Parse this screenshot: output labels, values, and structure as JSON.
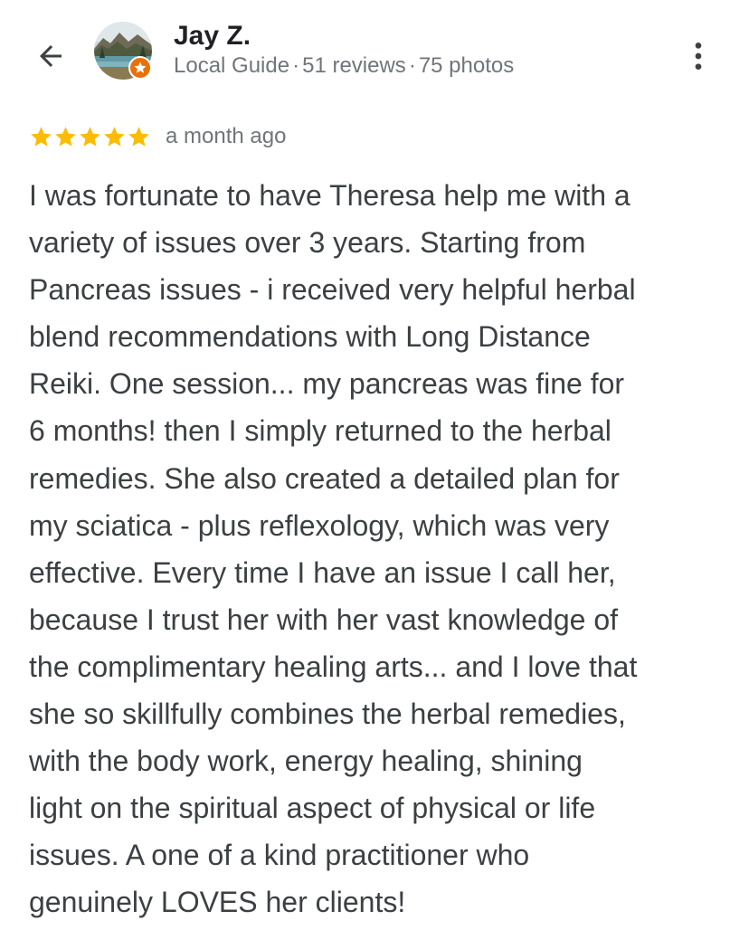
{
  "reviewer": {
    "name": "Jay Z.",
    "badge": "Local Guide",
    "reviews": "51 reviews",
    "photos": "75 photos",
    "separator": "·",
    "avatar_icon": "landscape-photo-avatar",
    "badge_icon": "local-guide-star-badge"
  },
  "review": {
    "rating": 5,
    "max_rating": 5,
    "time": "a month ago",
    "text": "I was fortunate to have Theresa help me with a\nvariety of issues over 3 years. Starting from\nPancreas issues - i received very helpful herbal\nblend recommendations with Long Distance\nReiki. One session... my pancreas was fine for\n6 months! then I simply returned to the herbal\nremedies. She also created a detailed plan for\nmy sciatica - plus reflexology, which was very\neffective. Every time I have an issue I call her,\nbecause I trust her with her vast knowledge of\nthe complimentary healing arts... and I love that\nshe so skillfully combines the herbal remedies,\nwith the body work, energy healing, shining\nlight on the spiritual aspect of physical or life\nissues. A one of a kind practitioner who\ngenuinely LOVES her clients!"
  },
  "icons": {
    "back": "back-arrow-icon",
    "more": "more-vert-icon",
    "star": "star-icon"
  },
  "colors": {
    "star": "#fbbc04",
    "badge": "#e8710a",
    "name": "#202124",
    "secondary_text": "#70757a",
    "body_text": "#3c4043"
  }
}
